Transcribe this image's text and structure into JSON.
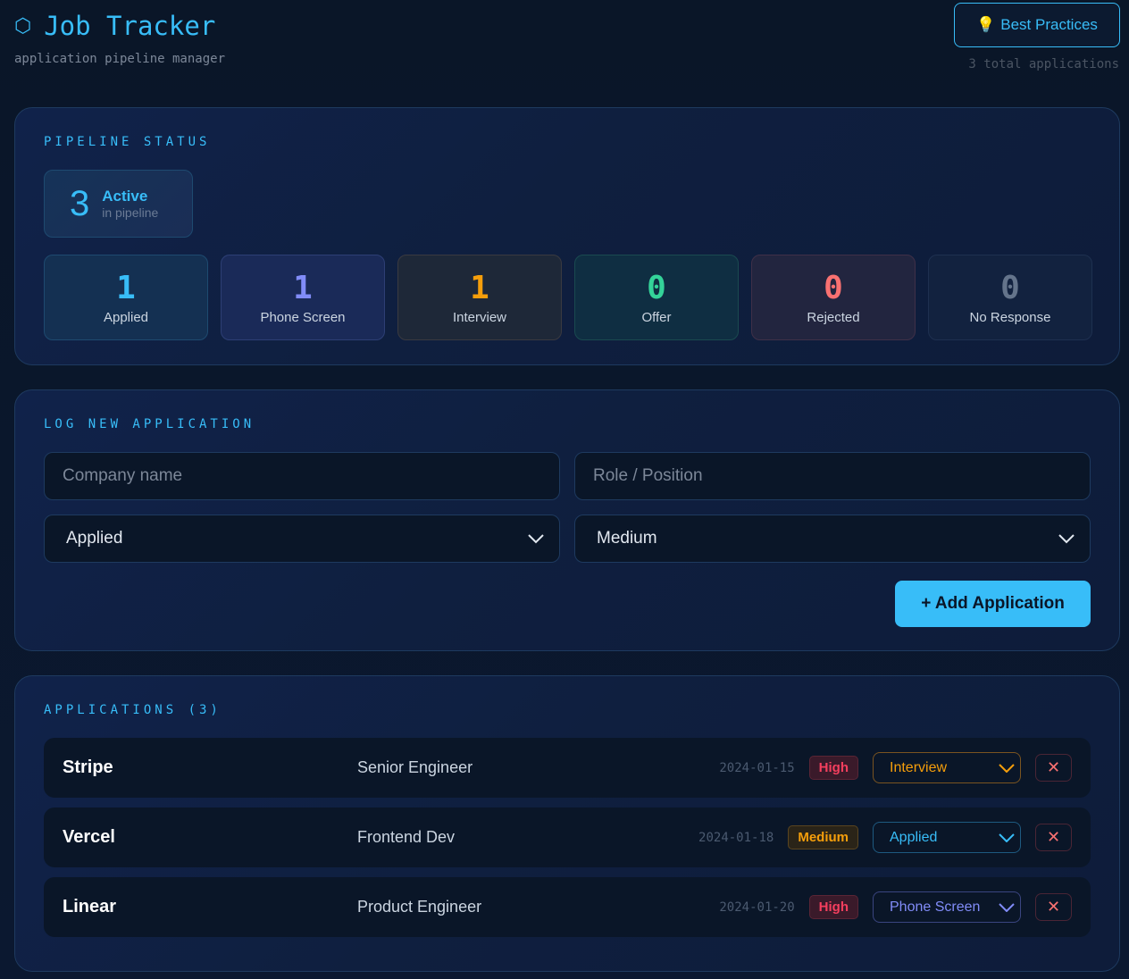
{
  "header": {
    "icon": "hexagon-icon",
    "title": "Job Tracker",
    "subtitle": "application pipeline manager",
    "best_practices": "Best Practices",
    "total": "3 total applications"
  },
  "pipeline": {
    "heading": "PIPELINE STATUS",
    "active_count": "3",
    "active_label": "Active",
    "active_sub": "in pipeline",
    "stats": [
      {
        "value": "1",
        "label": "Applied",
        "color": "#38bdf8"
      },
      {
        "value": "1",
        "label": "Phone Screen",
        "color": "#818cf8"
      },
      {
        "value": "1",
        "label": "Interview",
        "color": "#f59e0b"
      },
      {
        "value": "0",
        "label": "Offer",
        "color": "#34d399"
      },
      {
        "value": "0",
        "label": "Rejected",
        "color": "#f87171"
      },
      {
        "value": "0",
        "label": "No Response",
        "color": "#64748b"
      }
    ]
  },
  "form": {
    "heading": "LOG NEW APPLICATION",
    "company_placeholder": "Company name",
    "role_placeholder": "Role / Position",
    "status_value": "Applied",
    "priority_value": "Medium",
    "add_label": "+ Add Application"
  },
  "applications": {
    "heading": "APPLICATIONS (3)",
    "rows": [
      {
        "company": "Stripe",
        "role": "Senior Engineer",
        "date": "2024-01-15",
        "priority": "High",
        "status": "Interview"
      },
      {
        "company": "Vercel",
        "role": "Frontend Dev",
        "date": "2024-01-18",
        "priority": "Medium",
        "status": "Applied"
      },
      {
        "company": "Linear",
        "role": "Product Engineer",
        "date": "2024-01-20",
        "priority": "High",
        "status": "Phone Screen"
      }
    ]
  }
}
